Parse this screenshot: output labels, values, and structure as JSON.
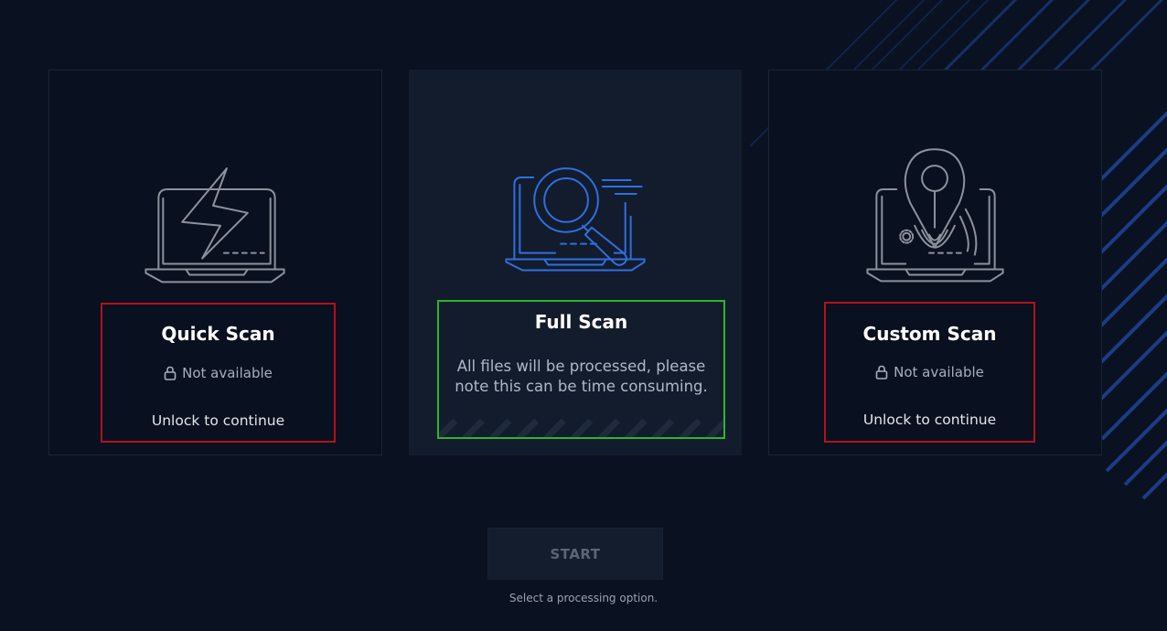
{
  "options": [
    {
      "title": "Quick Scan",
      "status": "Not available",
      "action": "Unlock to continue",
      "icon": "laptop-lightning-icon"
    },
    {
      "title": "Full Scan",
      "description": "All files will be processed, please note this can be time consuming.",
      "icon": "laptop-magnifier-icon"
    },
    {
      "title": "Custom Scan",
      "status": "Not available",
      "action": "Unlock to continue",
      "icon": "laptop-location-pin-icon"
    }
  ],
  "start_button": {
    "label": "START"
  },
  "hint": "Select a processing option.",
  "colors": {
    "background": "#0a1120",
    "locked_border": "#b3121a",
    "selected_border": "#2cb52c",
    "accent_blue": "#2f6fe0",
    "icon_gray": "#8c929c"
  }
}
